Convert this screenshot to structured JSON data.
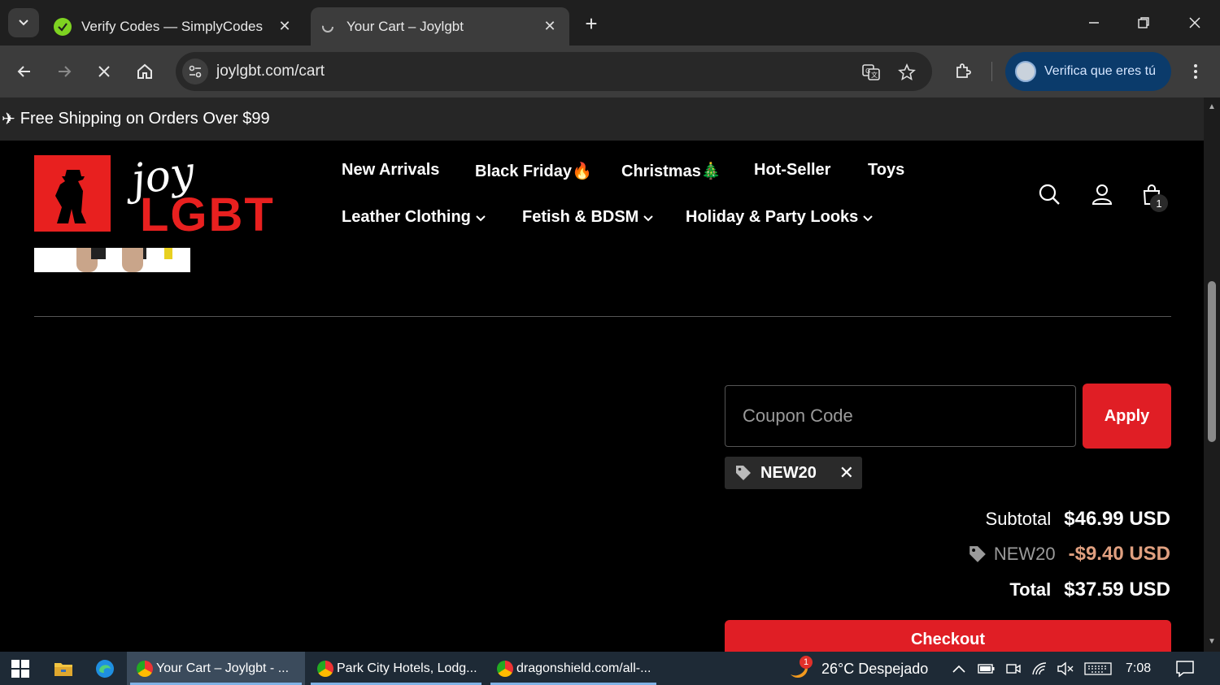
{
  "browser": {
    "tabs": [
      {
        "title": "Verify Codes — SimplyCodes",
        "active": false
      },
      {
        "title": "Your Cart – Joylgbt",
        "active": true
      }
    ],
    "url": "joylgbt.com/cart",
    "profile_label": "Verifica que eres tú"
  },
  "store": {
    "announcement": "Free Shipping on Orders Over $99",
    "logo_text_script": "joy",
    "logo_text_word": "LGBT",
    "nav": {
      "row1": [
        "New Arrivals",
        "Black Friday🔥",
        "Christmas🎄",
        "Hot-Seller",
        "Toys"
      ],
      "row2": [
        "Leather Clothing",
        "Fetish & BDSM",
        "Holiday & Party Looks"
      ]
    },
    "cart_count": "1"
  },
  "cart": {
    "coupon_placeholder": "Coupon Code",
    "apply_label": "Apply",
    "applied_code": "NEW20",
    "subtotal_label": "Subtotal",
    "subtotal_value": "$46.99 USD",
    "discount_label": "NEW20",
    "discount_value": "-$9.40 USD",
    "total_label": "Total",
    "total_value": "$37.59 USD",
    "checkout_label": "Checkout"
  },
  "taskbar": {
    "apps": [
      {
        "label": "Your Cart – Joylgbt - ...",
        "active": true
      },
      {
        "label": "Park City Hotels, Lodg...",
        "active": false
      },
      {
        "label": "dragonshield.com/all-...",
        "active": false
      }
    ],
    "weather_badge": "1",
    "weather": "26°C  Despejado",
    "time": "7:08"
  },
  "colors": {
    "brand_red": "#e8201f",
    "button_red": "#e01e25",
    "discount_text": "#e0a080",
    "profile_pill": "#0b3b6b"
  }
}
